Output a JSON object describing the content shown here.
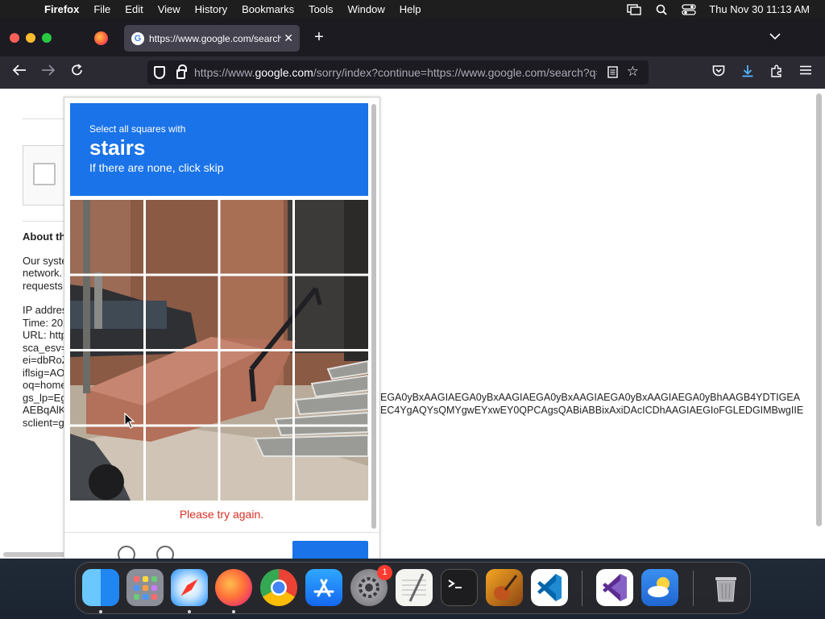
{
  "menubar": {
    "app": "Firefox",
    "items": [
      "File",
      "Edit",
      "View",
      "History",
      "Bookmarks",
      "Tools",
      "Window",
      "Help"
    ],
    "clock": "Thu Nov 30  11:13 AM"
  },
  "tab": {
    "title": "https://www.google.com/search?q",
    "close": "✕"
  },
  "url": {
    "prefix": "https://www.",
    "domain": "google.com",
    "rest": "/sorry/index?continue=https://www.google.com/search?q=stairs&sca_esv"
  },
  "page": {
    "about_heading": "About th",
    "paragraph": [
      "Our syste",
      "network.",
      "requests"
    ],
    "details": [
      "IP addres",
      "Time: 202",
      "URL: http",
      "sca_esv=",
      "ei=dbRoZ",
      "iflsig=AO",
      "oq=home",
      "gs_lp=Eg",
      "AEBqAlK",
      "sclient=g"
    ],
    "overflow_lines": [
      "EGA0yBxAAGIAEGA0yBxAAGIAEGA0yBxAAGIAEGA0yBxAAGIAEGA0yBhAAGB4YDTIGEA",
      "EC4YgAQYsQMYgwEYxwEY0QPCAgsQABiABBixAxiDAcICDhAAGIAEGIoFGLEDGIMBwgIIE"
    ]
  },
  "captcha": {
    "instruction": "Select all squares with",
    "target": "stairs",
    "sub": "If there are none, click skip",
    "error": "Please try again."
  },
  "dock": {
    "apps": [
      "finder-icon",
      "launchpad-icon",
      "safari-icon",
      "firefox-icon",
      "chrome-icon",
      "app-store-icon",
      "system-settings-icon",
      "textedit-icon",
      "terminal-icon",
      "garageband-icon",
      "vscode-icon",
      "visual-studio-icon",
      "weather-icon",
      "trash-icon"
    ],
    "settings_badge": "1"
  },
  "colors": {
    "captcha_blue": "#1a73e8",
    "error_red": "#d93025",
    "firefox_dark": "#1c1b22"
  }
}
